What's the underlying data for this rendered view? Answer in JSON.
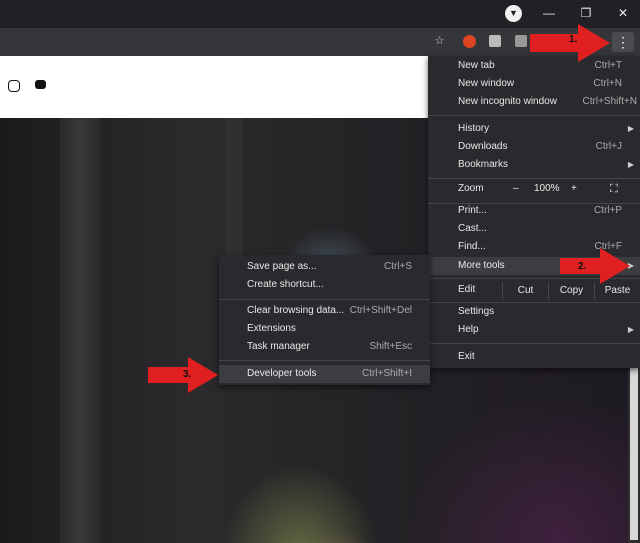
{
  "window": {
    "minimize": "—",
    "restore": "❐",
    "close": "✕"
  },
  "toolbar": {
    "menu_glyph": "⋮",
    "star_glyph": "☆"
  },
  "menu": {
    "items": [
      {
        "label": "New tab",
        "shortcut": "Ctrl+T"
      },
      {
        "label": "New window",
        "shortcut": "Ctrl+N"
      },
      {
        "label": "New incognito window",
        "shortcut": "Ctrl+Shift+N"
      },
      {
        "label": "History",
        "shortcut": ""
      },
      {
        "label": "Downloads",
        "shortcut": "Ctrl+J"
      },
      {
        "label": "Bookmarks",
        "shortcut": ""
      },
      {
        "label": "Print...",
        "shortcut": "Ctrl+P"
      },
      {
        "label": "Cast...",
        "shortcut": ""
      },
      {
        "label": "Find...",
        "shortcut": "Ctrl+F"
      },
      {
        "label": "More tools",
        "shortcut": ""
      },
      {
        "label": "Settings",
        "shortcut": ""
      },
      {
        "label": "Help",
        "shortcut": ""
      },
      {
        "label": "Exit",
        "shortcut": ""
      }
    ],
    "zoom": {
      "label": "Zoom",
      "minus": "–",
      "value": "100%",
      "plus": "+"
    },
    "edit": {
      "label": "Edit",
      "cut": "Cut",
      "copy": "Copy",
      "paste": "Paste"
    }
  },
  "submenu": {
    "items": [
      {
        "label": "Save page as...",
        "shortcut": "Ctrl+S"
      },
      {
        "label": "Create shortcut...",
        "shortcut": ""
      },
      {
        "label": "Clear browsing data...",
        "shortcut": "Ctrl+Shift+Del"
      },
      {
        "label": "Extensions",
        "shortcut": ""
      },
      {
        "label": "Task manager",
        "shortcut": "Shift+Esc"
      },
      {
        "label": "Developer tools",
        "shortcut": "Ctrl+Shift+I"
      }
    ]
  },
  "annotations": {
    "step1": "1.",
    "step2": "2.",
    "step3": "3."
  },
  "colors": {
    "arrow": "#e02020",
    "menu_bg": "#292a2d"
  }
}
